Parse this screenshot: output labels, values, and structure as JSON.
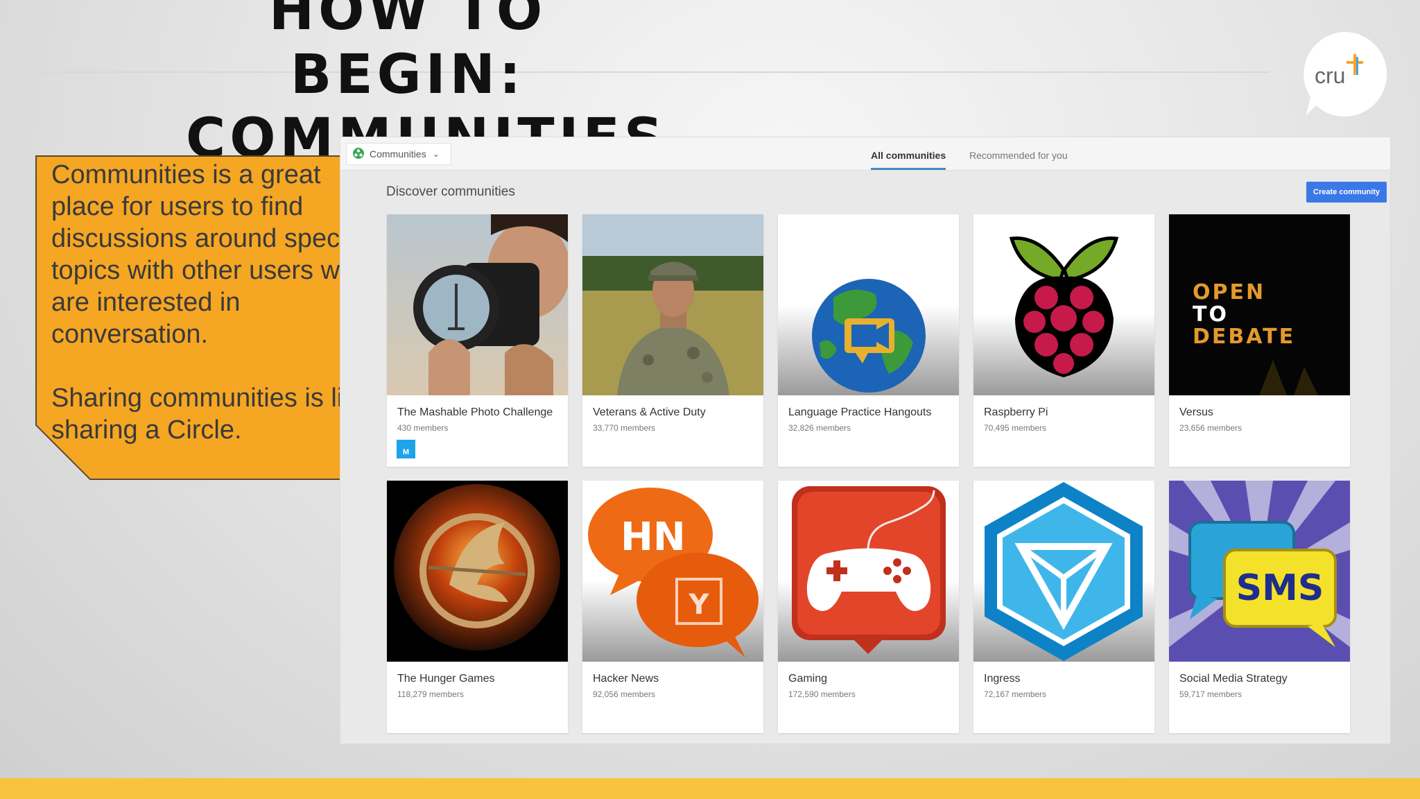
{
  "slide": {
    "title_line1": "HOW TO BEGIN:",
    "title_line2": "COMMUNITIES",
    "logo_text": "cru",
    "callout": {
      "paragraph1": "Communities is a great place for users to find discussions around specific topics with other users who are interested in conversation.",
      "paragraph2": "Sharing communities is like sharing a Circle."
    },
    "colors": {
      "callout": "#f5a623",
      "bottom_bar": "#f8c440",
      "accent_blue": "#3b78e7"
    }
  },
  "app": {
    "dropdown_label": "Communities",
    "dropdown_icon": "communities-icon",
    "tabs": [
      {
        "label": "All communities",
        "active": true
      },
      {
        "label": "Recommended for you",
        "active": false
      }
    ],
    "section_title": "Discover communities",
    "create_button": "Create community",
    "cards": [
      {
        "name": "The Mashable Photo Challenge",
        "members": "430 members",
        "image": "photographer-image",
        "badge": "M"
      },
      {
        "name": "Veterans & Active Duty",
        "members": "33,770 members",
        "image": "soldier-image"
      },
      {
        "name": "Language Practice Hangouts",
        "members": "32,826 members",
        "image": "globe-video-icon"
      },
      {
        "name": "Raspberry Pi",
        "members": "70,495 members",
        "image": "raspberry-icon"
      },
      {
        "name": "Versus",
        "members": "23,656 members",
        "image": "open-to-debate-image",
        "image_text": [
          "OPEN",
          "TO",
          "DEBATE"
        ]
      },
      {
        "name": "The Hunger Games",
        "members": "118,279 members",
        "image": "mockingjay-image"
      },
      {
        "name": "Hacker News",
        "members": "92,056 members",
        "image": "hn-bubbles-icon",
        "image_text": [
          "HN",
          "Y"
        ]
      },
      {
        "name": "Gaming",
        "members": "172,590 members",
        "image": "gamepad-icon"
      },
      {
        "name": "Ingress",
        "members": "72,167 members",
        "image": "ingress-icon"
      },
      {
        "name": "Social Media Strategy",
        "members": "59,717 members",
        "image": "sms-bubble-icon",
        "image_text": [
          "SMS"
        ]
      }
    ]
  }
}
